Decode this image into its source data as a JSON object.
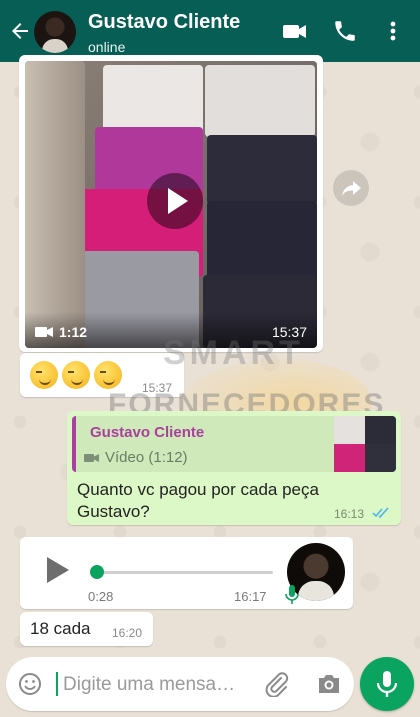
{
  "header": {
    "contact_name": "Gustavo Cliente",
    "status": "online",
    "icons": [
      "back-arrow-icon",
      "video-call-icon",
      "phone-icon",
      "more-vertical-icon"
    ],
    "color": "#075e54"
  },
  "messages": {
    "video": {
      "duration": "1:12",
      "time": "15:37"
    },
    "emoji": {
      "emojis": [
        "😏",
        "😏",
        "😏"
      ],
      "time": "15:37"
    },
    "reply": {
      "quoted_name": "Gustavo Cliente",
      "quoted_type": "Vídeo (1:12)",
      "text": "Quanto vc pagou por cada peça Gustavo?",
      "time": "16:13",
      "status": "read"
    },
    "audio": {
      "duration": "0:28",
      "time": "16:17",
      "progress": 0
    },
    "text": {
      "body": "18 cada",
      "time": "16:20"
    }
  },
  "watermark": {
    "line1": "SMART",
    "line2": "FORNECEDORES"
  },
  "composer": {
    "placeholder": "Digite uma mensa…"
  },
  "colors": {
    "accent": "#0ba360",
    "outgoing_bubble": "#dcf8c6",
    "quote_name": "#a9409e"
  }
}
